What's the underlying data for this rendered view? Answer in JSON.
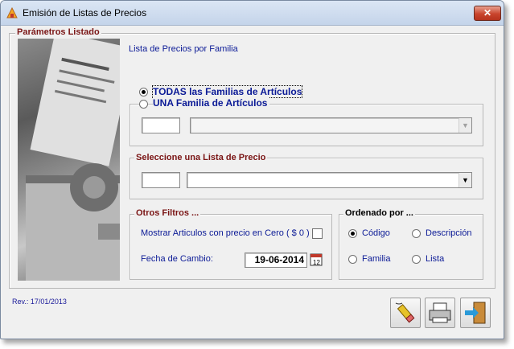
{
  "window": {
    "title": "Emisión de Listas de Precios",
    "close_glyph": "✕"
  },
  "params": {
    "group_title": "Parámetros Listado",
    "heading": "Lista de Precios por Familia",
    "option_all": "TODAS las Familias de Artículos",
    "option_one": "UNA Familia de Artículos",
    "family_code": "",
    "family_name": ""
  },
  "price_list": {
    "group_title": "Seleccione una Lista de Precio",
    "code": "",
    "name": ""
  },
  "filters": {
    "group_title": "Otros Filtros ...",
    "zero_price_label": "Mostrar Articulos con precio en Cero ( $ 0 )",
    "zero_price_checked": false,
    "date_label": "Fecha de Cambio:",
    "date_value": "19-06-2014"
  },
  "order": {
    "group_title": "Ordenado por ...",
    "options": [
      "Código",
      "Descripción",
      "Familia",
      "Lista"
    ],
    "selected": "Código"
  },
  "footer": {
    "revision": "Rev.: 17/01/2013"
  },
  "icons": [
    "app-icon",
    "close-icon",
    "calendar-icon",
    "clear-icon",
    "printer-icon",
    "exit-door-icon"
  ]
}
